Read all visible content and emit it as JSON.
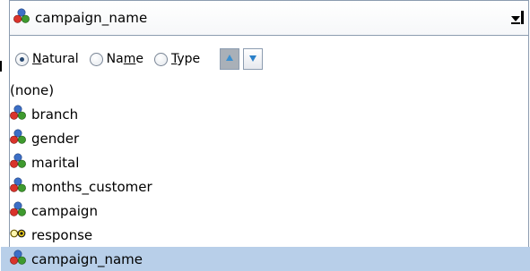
{
  "combo": {
    "selected_label": "campaign_name",
    "selected_icon": "set-field-icon",
    "dropdown_icon": "dropdown-arrow-icon"
  },
  "sort": {
    "options": [
      {
        "label_pre": "",
        "label_ul": "N",
        "label_post": "atural",
        "checked": true
      },
      {
        "label_pre": "Na",
        "label_ul": "m",
        "label_post": "e",
        "checked": false
      },
      {
        "label_pre": "",
        "label_ul": "T",
        "label_post": "ype",
        "checked": false
      }
    ],
    "ascending_icon": "sort-ascending-icon",
    "descending_icon": "sort-descending-icon"
  },
  "list": {
    "none_label": "(none)",
    "items": [
      {
        "label": "branch",
        "icon": "set-field-icon"
      },
      {
        "label": "gender",
        "icon": "set-field-icon"
      },
      {
        "label": "marital",
        "icon": "set-field-icon"
      },
      {
        "label": "months_customer",
        "icon": "set-field-icon"
      },
      {
        "label": "campaign",
        "icon": "set-field-icon"
      },
      {
        "label": "response",
        "icon": "flag-field-icon"
      },
      {
        "label": "campaign_name",
        "icon": "set-field-icon",
        "selected": true
      }
    ]
  },
  "colors": {
    "selection": "#b8cfe9",
    "border": "#8c9cb0",
    "set_red": "#d9332b",
    "set_green": "#3e9a2e",
    "set_blue": "#3c6fc6",
    "flag_yellow": "#f2d21a"
  }
}
